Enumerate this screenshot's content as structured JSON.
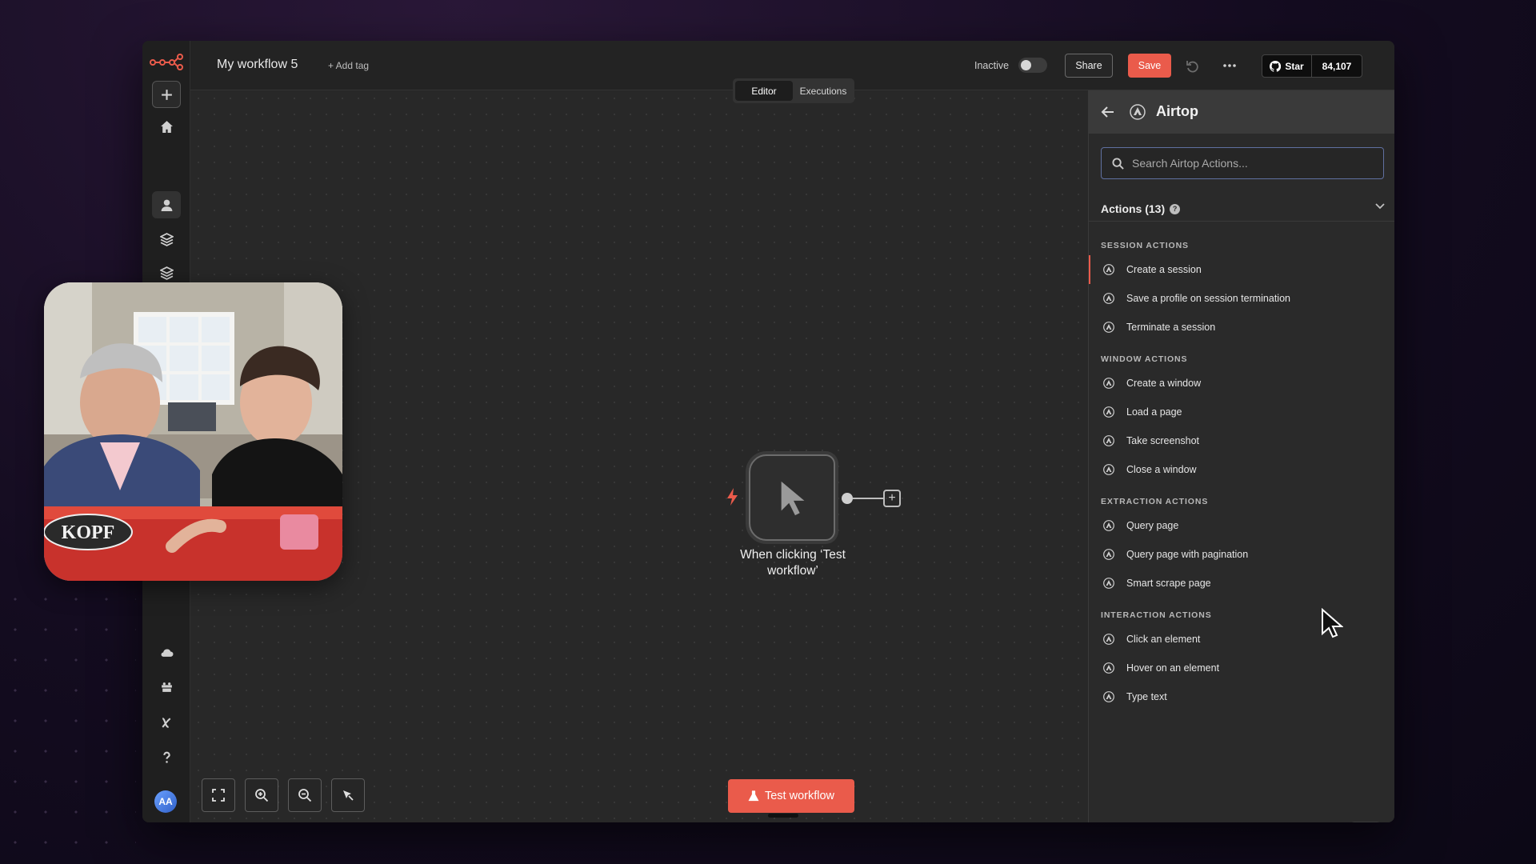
{
  "header": {
    "workflow_name": "My workflow 5",
    "add_tag": "+ Add tag",
    "status_label": "Inactive",
    "share_label": "Share",
    "save_label": "Save",
    "github_star_label": "Star",
    "github_star_count": "84,107"
  },
  "tabs": [
    {
      "label": "Editor",
      "active": true
    },
    {
      "label": "Executions",
      "active": false
    }
  ],
  "canvas": {
    "node_label": "When clicking ‘Test workflow’",
    "test_button_label": "Test workflow"
  },
  "panel": {
    "title": "Airtop",
    "search_placeholder": "Search Airtop Actions...",
    "actions_heading": "Actions (13)",
    "groups": [
      {
        "title": "SESSION ACTIONS",
        "items": [
          "Create a session",
          "Save a profile on session termination",
          "Terminate a session"
        ]
      },
      {
        "title": "WINDOW ACTIONS",
        "items": [
          "Create a window",
          "Load a page",
          "Take screenshot",
          "Close a window"
        ]
      },
      {
        "title": "EXTRACTION ACTIONS",
        "items": [
          "Query page",
          "Query page with pagination",
          "Smart scrape page"
        ]
      },
      {
        "title": "INTERACTION ACTIONS",
        "items": [
          "Click an element",
          "Hover on an element",
          "Type text"
        ]
      }
    ]
  },
  "user": {
    "avatar_initials": "AA"
  },
  "overlay": {
    "webcam_laptop_sticker": "KOPF"
  },
  "colors": {
    "accent": "#ea5b4b",
    "panel_bg": "#2a2a2a",
    "canvas_bg": "#282828"
  }
}
